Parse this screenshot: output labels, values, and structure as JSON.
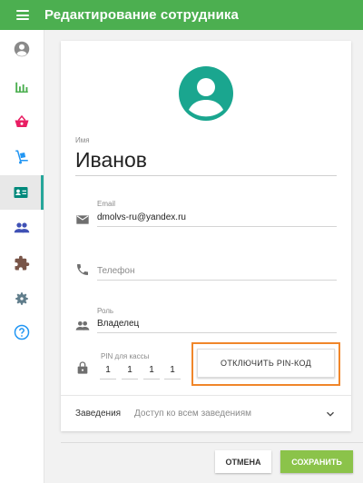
{
  "header": {
    "title": "Редактирование сотрудника",
    "menu_icon": "menu-icon"
  },
  "sidebar": {
    "active_index": 4,
    "items": [
      {
        "name": "account-icon",
        "color": "#8a8a8a"
      },
      {
        "name": "bar-chart-icon",
        "color": "#4caf50"
      },
      {
        "name": "basket-icon",
        "color": "#e91e63"
      },
      {
        "name": "hand-truck-icon",
        "color": "#2196f3"
      },
      {
        "name": "contact-card-icon",
        "color": "#00897b"
      },
      {
        "name": "people-icon",
        "color": "#3f51b5"
      },
      {
        "name": "puzzle-icon",
        "color": "#795548"
      },
      {
        "name": "gear-icon",
        "color": "#607d8b"
      },
      {
        "name": "help-icon",
        "color": "#2196f3"
      }
    ]
  },
  "form": {
    "avatar_icon": "account-circle-icon",
    "avatar_color": "#1aa68f",
    "name": {
      "label": "Имя",
      "value": "Иванов"
    },
    "email": {
      "label": "Email",
      "value": "dmolvs-ru@yandex.ru",
      "icon": "mail-icon"
    },
    "phone": {
      "placeholder": "Телефон",
      "icon": "phone-icon"
    },
    "role": {
      "label": "Роль",
      "value": "Владелец",
      "icon": "people-icon"
    },
    "pin": {
      "label": "PIN для кассы",
      "digits": [
        "1",
        "1",
        "1",
        "1"
      ],
      "icon": "lock-icon"
    },
    "pin_button_label": "ОТКЛЮЧИТЬ PIN-КОД",
    "highlight_color": "#f0862a",
    "venues": {
      "label": "Заведения",
      "value": "Доступ ко всем заведениям"
    }
  },
  "actions": {
    "cancel_label": "ОТМЕНА",
    "save_label": "СОХРАНИТЬ",
    "save_color": "#8bc34a"
  }
}
